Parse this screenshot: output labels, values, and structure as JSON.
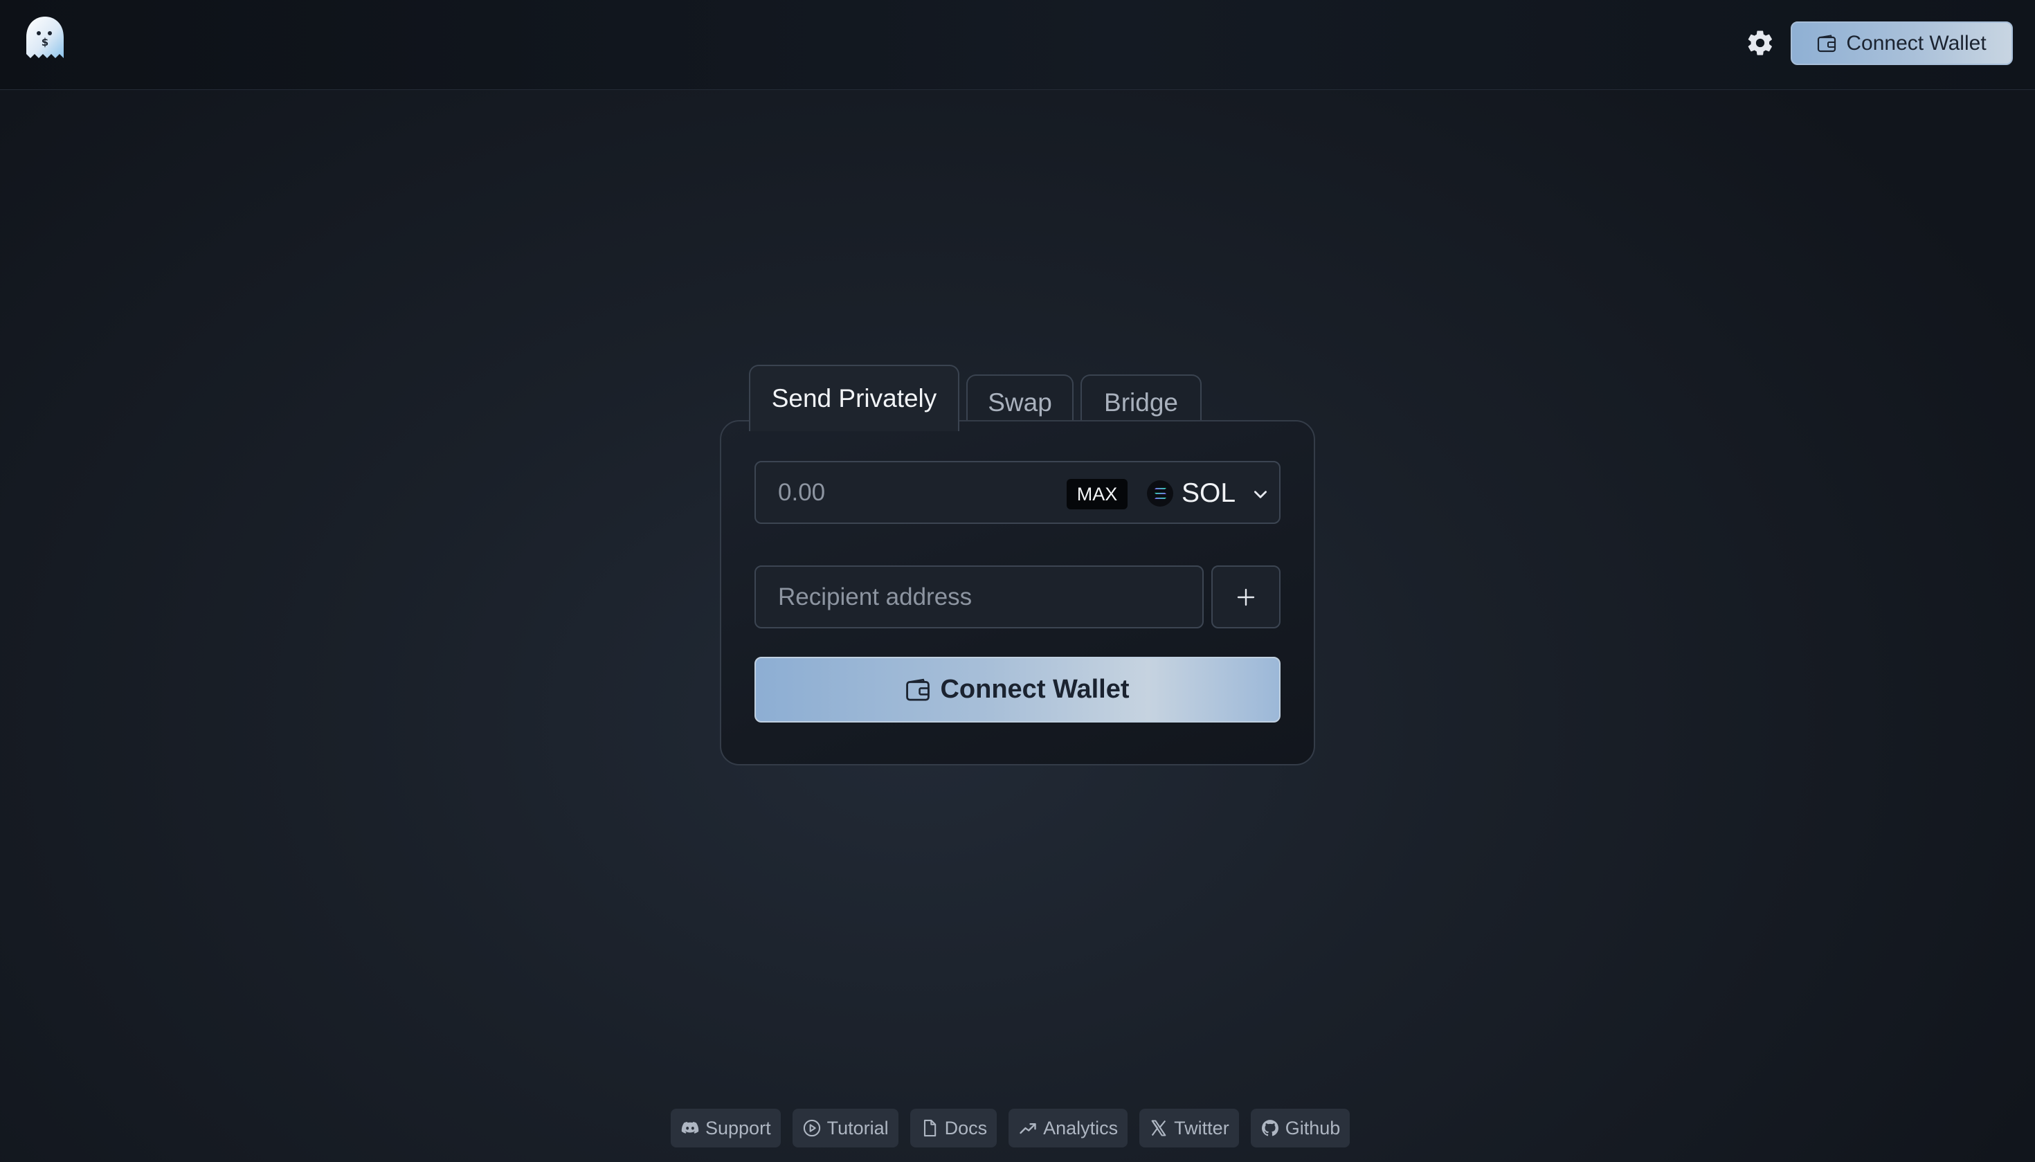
{
  "header": {
    "connect_wallet_label": "Connect Wallet"
  },
  "tabs": [
    {
      "label": "Send Privately",
      "active": true
    },
    {
      "label": "Swap",
      "active": false
    },
    {
      "label": "Bridge",
      "active": false
    }
  ],
  "send_form": {
    "amount_placeholder": "0.00",
    "amount_value": "",
    "max_label": "MAX",
    "token": "SOL",
    "recipient_placeholder": "Recipient address",
    "recipient_value": "",
    "connect_wallet_label": "Connect Wallet"
  },
  "footer": {
    "links": [
      {
        "label": "Support",
        "icon": "discord-icon"
      },
      {
        "label": "Tutorial",
        "icon": "play-icon"
      },
      {
        "label": "Docs",
        "icon": "file-icon"
      },
      {
        "label": "Analytics",
        "icon": "trend-icon"
      },
      {
        "label": "Twitter",
        "icon": "x-icon"
      },
      {
        "label": "Github",
        "icon": "github-icon"
      }
    ]
  },
  "colors": {
    "accent_start": "#8fb0d4",
    "accent_end": "#c8d5e2",
    "background": "#1a2029"
  }
}
